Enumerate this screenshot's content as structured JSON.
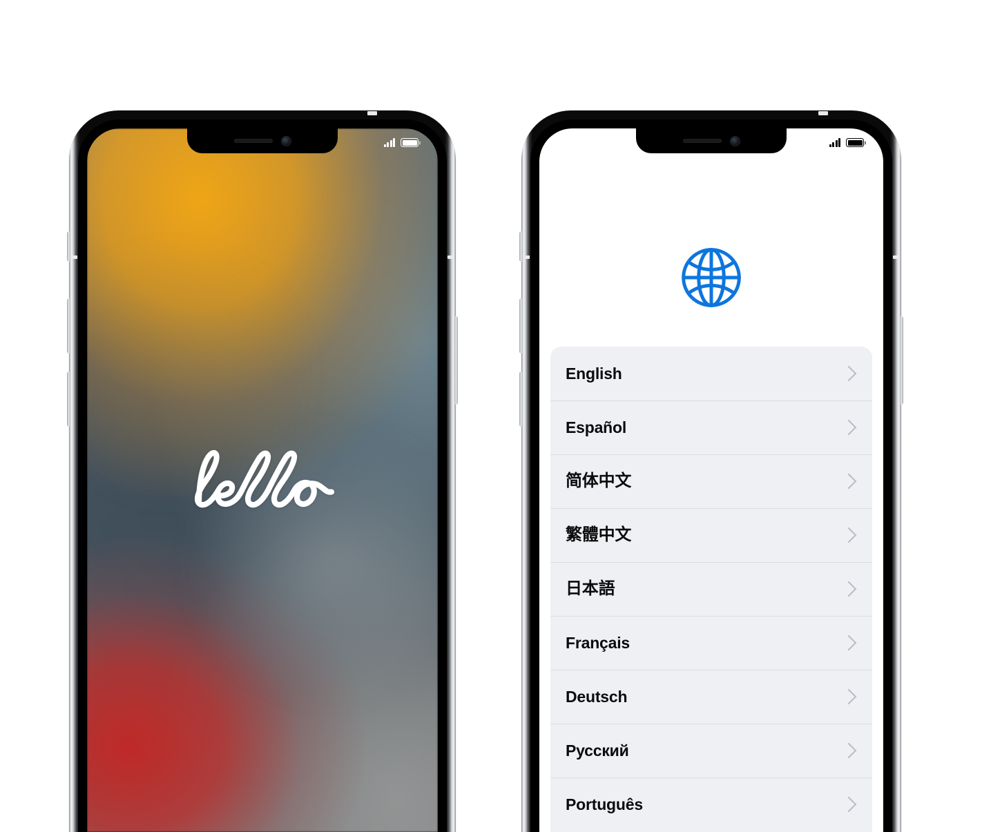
{
  "scene": {
    "background_color": "#ffffff",
    "description": "Two iPhone mockups side by side"
  },
  "phone_left": {
    "name": "hello-lock-screen-phone",
    "frame_color": "#c8cacd",
    "status_bar": {
      "signal_icon": "signal-bars-icon",
      "signal_bars": 4,
      "battery_icon": "battery-full-icon",
      "battery_level": 100,
      "tint": "#ffffff"
    },
    "notch": {
      "speaker_icon": "speaker-grille-icon",
      "camera_icon": "front-camera-icon"
    },
    "wallpaper": {
      "name": "ios15-abstract-gradient",
      "colors": [
        "#f2a614",
        "#c12826",
        "#3e4c58",
        "#748c96",
        "#8b8c8d"
      ]
    },
    "greeting": {
      "text": "hello",
      "color": "#ffffff",
      "style": "handwritten-script"
    }
  },
  "phone_right": {
    "name": "language-picker-phone",
    "frame_color": "#c8cacd",
    "status_bar": {
      "signal_icon": "signal-bars-icon",
      "signal_bars": 4,
      "battery_icon": "battery-full-icon",
      "battery_level": 100,
      "tint": "#000000"
    },
    "notch": {
      "speaker_icon": "speaker-grille-icon",
      "camera_icon": "front-camera-icon"
    },
    "globe": {
      "icon": "globe-icon",
      "color": "#0d76de"
    },
    "list": {
      "background_color": "#eef0f4",
      "separator_color": "#dcdee3",
      "chevron_icon": "chevron-right-icon",
      "chevron_color": "#b9bcc3",
      "items": [
        {
          "label": "English",
          "script": "latin"
        },
        {
          "label": "Español",
          "script": "latin"
        },
        {
          "label": "简体中文",
          "script": "cjk"
        },
        {
          "label": "繁體中文",
          "script": "cjk"
        },
        {
          "label": "日本語",
          "script": "cjk"
        },
        {
          "label": "Français",
          "script": "latin"
        },
        {
          "label": "Deutsch",
          "script": "latin"
        },
        {
          "label": "Русский",
          "script": "latin"
        },
        {
          "label": "Português",
          "script": "latin"
        }
      ]
    }
  }
}
